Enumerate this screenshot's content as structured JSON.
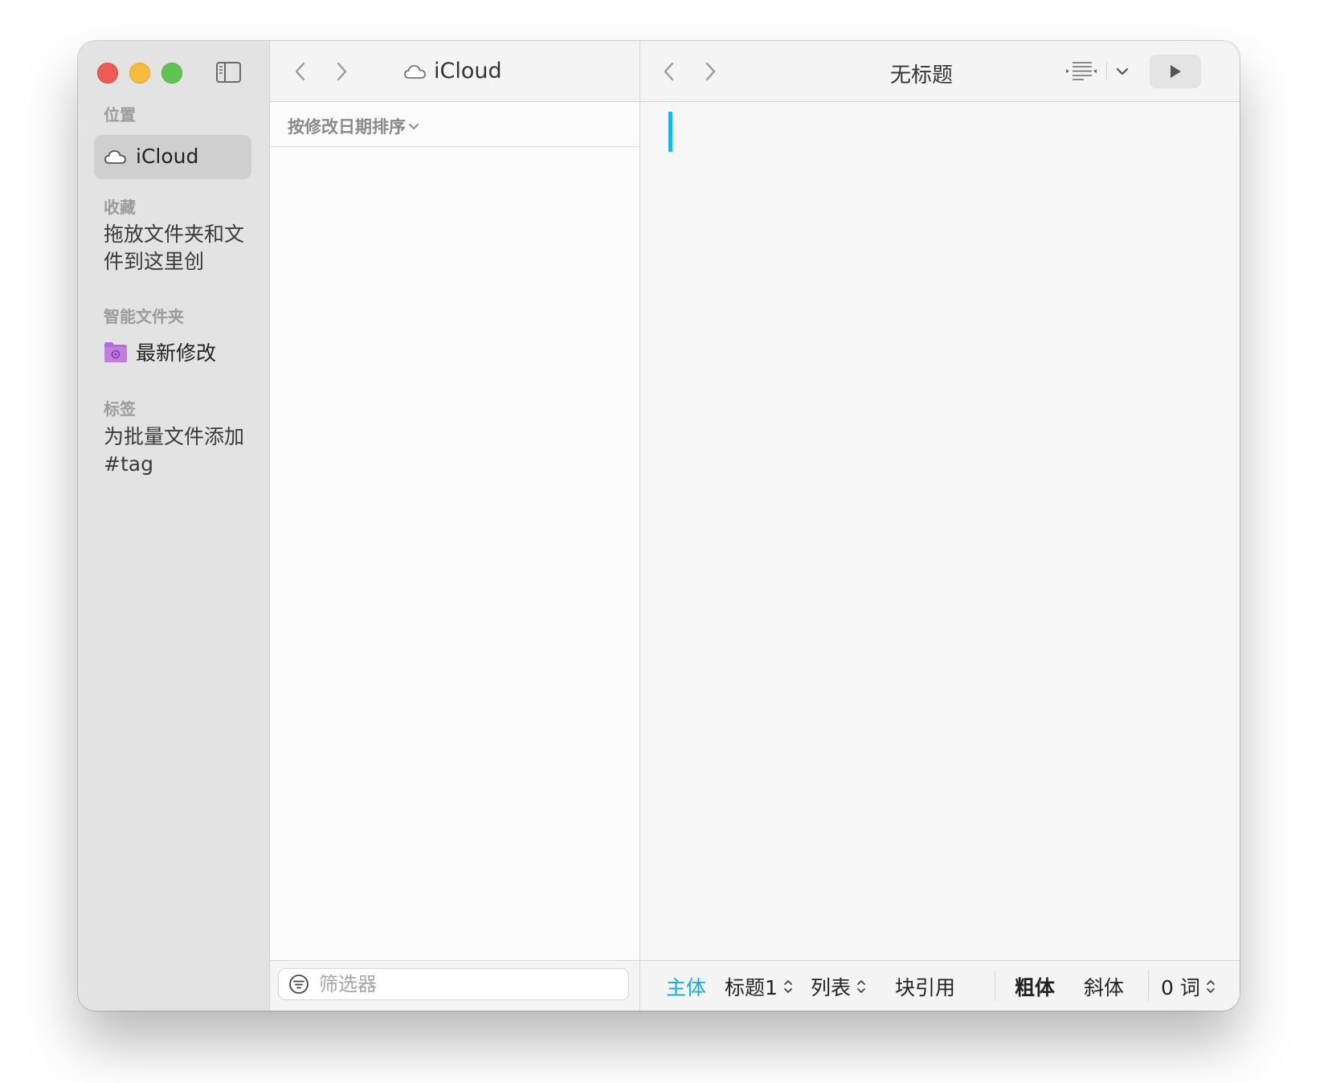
{
  "sidebar": {
    "sections": {
      "locations": "位置",
      "favorites": "收藏",
      "smart_folders": "智能文件夹",
      "tags": "标签"
    },
    "icloud_label": "iCloud",
    "favorites_hint": "拖放文件夹和文件到这里创",
    "recent_label": "最新修改",
    "tags_hint": "为批量文件添加#tag"
  },
  "middle": {
    "title": "iCloud",
    "sort_label": "按修改日期排序",
    "filter_placeholder": "筛选器"
  },
  "editor": {
    "title": "无标题",
    "format_bar": {
      "body": "主体",
      "heading": "标题1",
      "list": "列表",
      "blockquote": "块引用",
      "bold": "粗体",
      "italic": "斜体",
      "word_count": "0 词"
    }
  },
  "colors": {
    "accent": "#19a9e6",
    "close": "#ee5b57",
    "minimize": "#f6bd3c",
    "zoom": "#5fc550",
    "smart_folder": "#b46ad8"
  },
  "icons": [
    "sidebar-toggle-icon",
    "back-icon",
    "forward-icon",
    "cloud-icon",
    "smart-folder-icon",
    "filter-icon",
    "outline-icon",
    "chevron-down-icon",
    "play-icon",
    "updown-icon"
  ]
}
